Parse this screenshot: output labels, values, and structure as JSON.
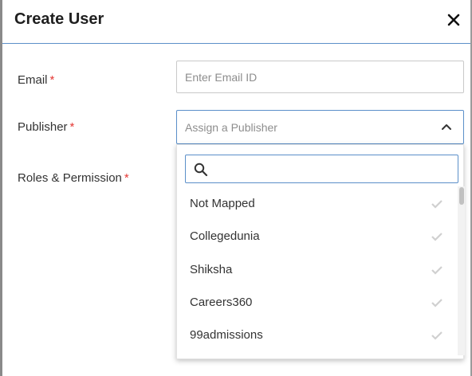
{
  "dialog": {
    "title": "Create User"
  },
  "form": {
    "email": {
      "label": "Email",
      "required_mark": "*",
      "placeholder": "Enter Email ID"
    },
    "publisher": {
      "label": "Publisher",
      "required_mark": "*",
      "placeholder": "Assign a Publisher",
      "expanded": true
    },
    "roles": {
      "label": "Roles & Permission",
      "required_mark": "*"
    }
  },
  "publisher_dropdown": {
    "search_value": "",
    "options": [
      {
        "label": "Not Mapped"
      },
      {
        "label": "Collegedunia"
      },
      {
        "label": "Shiksha"
      },
      {
        "label": "Careers360"
      },
      {
        "label": "99admissions"
      }
    ]
  },
  "icons": {
    "close": "close-icon",
    "chevron": "chevron-up-icon",
    "search": "search-icon",
    "check": "check-icon"
  },
  "colors": {
    "accent": "#5b8fc9",
    "required": "#e53935",
    "check": "#d0d0d0"
  }
}
